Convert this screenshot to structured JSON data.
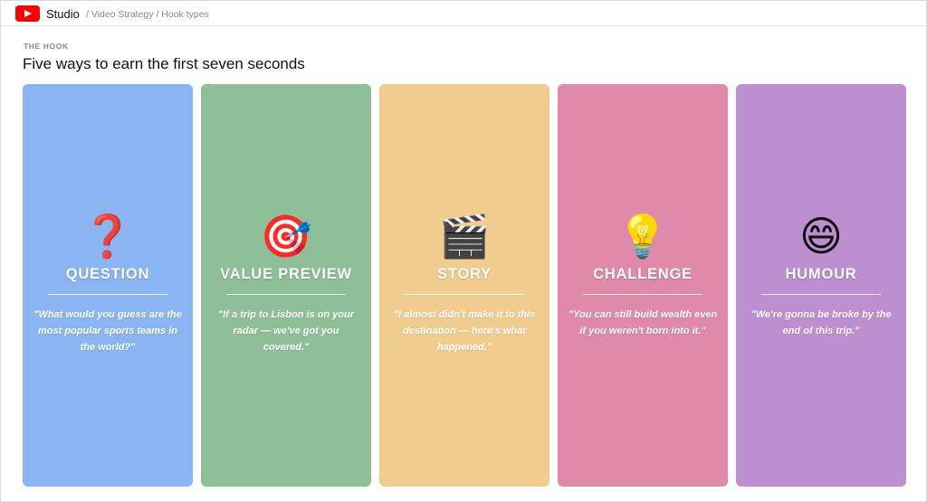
{
  "header": {
    "logo_icon": "youtube-play-icon",
    "app_name": "Studio",
    "breadcrumb": "/ Video Strategy / Hook types"
  },
  "section": {
    "kicker": "THE HOOK",
    "title": "Five ways to earn the first seven seconds"
  },
  "cards": [
    {
      "icon_name": "question-mark-icon",
      "emoji": "❓",
      "label": "QUESTION",
      "color": "#8ab4f2",
      "quote": "\"What would you guess are the most popular sports teams in the world?\""
    },
    {
      "icon_name": "target-dart-icon",
      "emoji": "🎯",
      "label": "VALUE PREVIEW",
      "color": "#8fbf99",
      "quote": "\"If a trip to Lisbon is on your radar — we've got you covered.\""
    },
    {
      "icon_name": "clapperboard-icon",
      "emoji": "🎬",
      "label": "STORY",
      "color": "#f0cd8f",
      "quote": "\"I almost didn't make it to this destination — here's what happened.\""
    },
    {
      "icon_name": "light-bulb-icon",
      "emoji": "💡",
      "label": "CHALLENGE",
      "color": "#df89ab",
      "quote": "\"You can still build wealth even if you weren't born into it.\""
    },
    {
      "icon_name": "grinning-face-icon",
      "emoji": "😄",
      "label": "HUMOUR",
      "color": "#bd8fd1",
      "quote": "\"We're gonna be broke by the end of this trip.\""
    }
  ]
}
